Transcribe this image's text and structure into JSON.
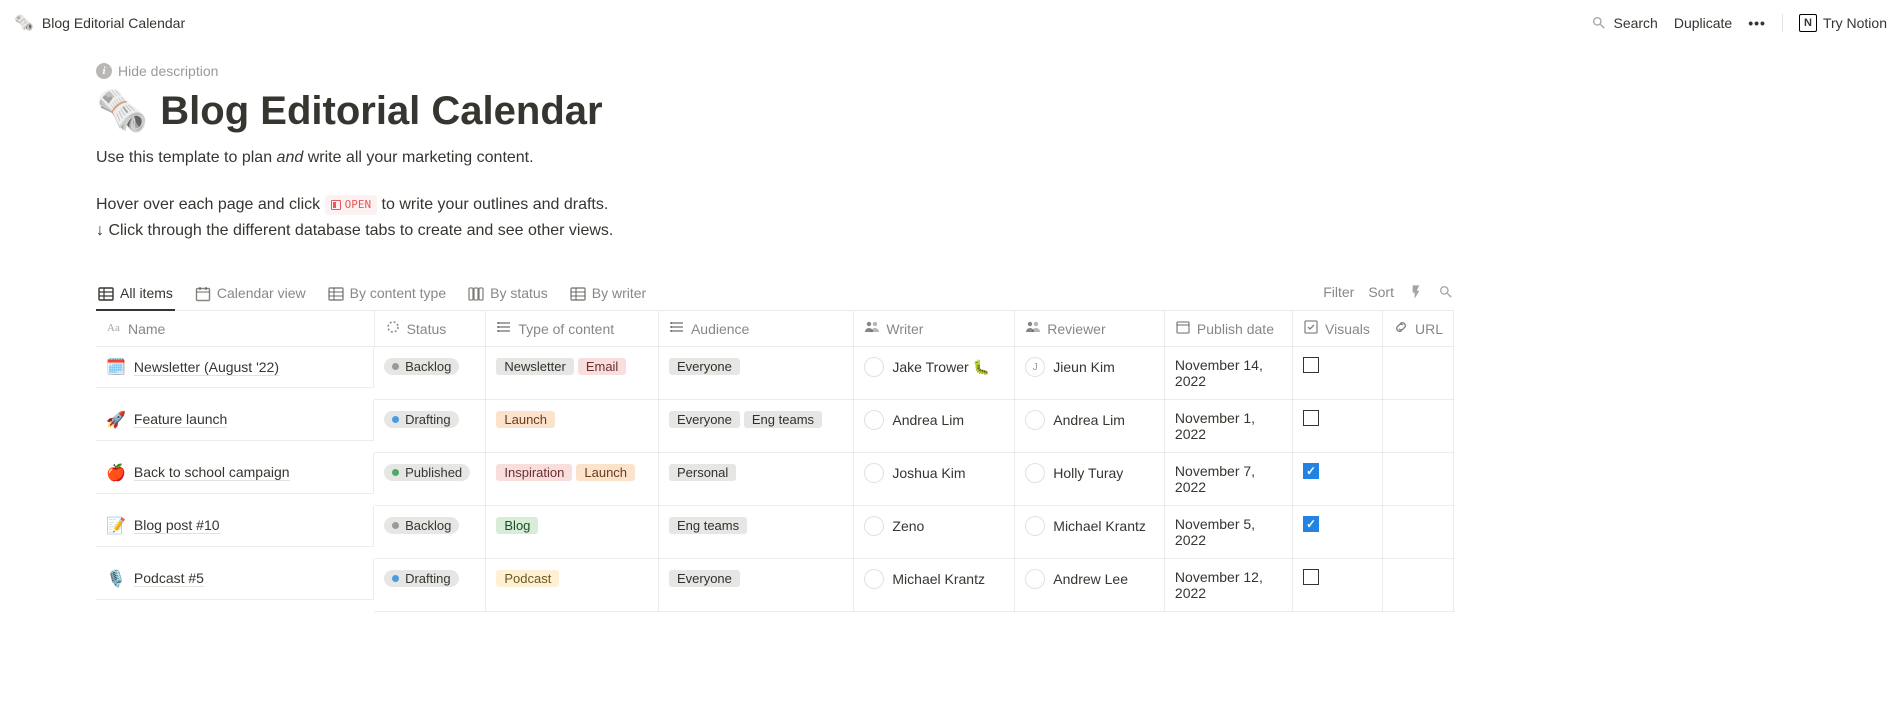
{
  "breadcrumb": {
    "icon": "🗞️",
    "title": "Blog Editorial Calendar"
  },
  "topbar": {
    "search": "Search",
    "duplicate": "Duplicate",
    "try_notion": "Try Notion"
  },
  "hide_description": "Hide description",
  "page": {
    "icon": "🗞️",
    "title": "Blog Editorial Calendar",
    "description_pre": "Use this template to plan ",
    "description_em": "and",
    "description_post": " write all your marketing content.",
    "hint_line1_pre": "Hover over each page and click ",
    "hint_open": "OPEN",
    "hint_line1_post": " to write your outlines and drafts.",
    "hint_line2": "↓ Click through the different database tabs to create and see other views."
  },
  "views": {
    "tabs": [
      {
        "label": "All items",
        "icon": "table",
        "active": true
      },
      {
        "label": "Calendar view",
        "icon": "calendar",
        "active": false
      },
      {
        "label": "By content type",
        "icon": "table",
        "active": false
      },
      {
        "label": "By status",
        "icon": "board",
        "active": false
      },
      {
        "label": "By writer",
        "icon": "table",
        "active": false
      }
    ],
    "actions": {
      "filter": "Filter",
      "sort": "Sort"
    }
  },
  "columns": [
    {
      "key": "name",
      "label": "Name",
      "icon": "title"
    },
    {
      "key": "status",
      "label": "Status",
      "icon": "status"
    },
    {
      "key": "type",
      "label": "Type of content",
      "icon": "multiselect"
    },
    {
      "key": "audience",
      "label": "Audience",
      "icon": "multiselect"
    },
    {
      "key": "writer",
      "label": "Writer",
      "icon": "person"
    },
    {
      "key": "reviewer",
      "label": "Reviewer",
      "icon": "person"
    },
    {
      "key": "date",
      "label": "Publish date",
      "icon": "date"
    },
    {
      "key": "visuals",
      "label": "Visuals",
      "icon": "checkbox"
    },
    {
      "key": "url",
      "label": "URL",
      "icon": "url"
    }
  ],
  "rows": [
    {
      "emoji": "🗓️",
      "title": "Newsletter (August '22)",
      "status": {
        "label": "Backlog",
        "variant": "gray"
      },
      "type": [
        {
          "label": "Newsletter",
          "variant": "default"
        },
        {
          "label": "Email",
          "variant": "pink"
        }
      ],
      "audience": [
        {
          "label": "Everyone",
          "variant": "default"
        }
      ],
      "writer": "Jake Trower 🐛",
      "reviewer": "Jieun Kim",
      "reviewer_initial": "J",
      "date": "November 14, 2022",
      "visuals": false
    },
    {
      "emoji": "🚀",
      "title": "Feature launch",
      "status": {
        "label": "Drafting",
        "variant": "blue"
      },
      "type": [
        {
          "label": "Launch",
          "variant": "orange"
        }
      ],
      "audience": [
        {
          "label": "Everyone",
          "variant": "default"
        },
        {
          "label": "Eng teams",
          "variant": "default"
        }
      ],
      "writer": "Andrea Lim",
      "reviewer": "Andrea Lim",
      "date": "November 1, 2022",
      "visuals": false
    },
    {
      "emoji": "🍎",
      "title": "Back to school campaign",
      "status": {
        "label": "Published",
        "variant": "green"
      },
      "type": [
        {
          "label": "Inspiration",
          "variant": "pink"
        },
        {
          "label": "Launch",
          "variant": "orange"
        }
      ],
      "audience": [
        {
          "label": "Personal",
          "variant": "default"
        }
      ],
      "writer": "Joshua Kim",
      "reviewer": "Holly Turay",
      "date": "November 7, 2022",
      "visuals": true
    },
    {
      "emoji": "📝",
      "title": "Blog post #10",
      "status": {
        "label": "Backlog",
        "variant": "gray"
      },
      "type": [
        {
          "label": "Blog",
          "variant": "green"
        }
      ],
      "audience": [
        {
          "label": "Eng teams",
          "variant": "default"
        }
      ],
      "writer": "Zeno",
      "reviewer": "Michael Krantz",
      "date": "November 5, 2022",
      "visuals": true
    },
    {
      "emoji": "🎙️",
      "title": "Podcast #5",
      "status": {
        "label": "Drafting",
        "variant": "blue"
      },
      "type": [
        {
          "label": "Podcast",
          "variant": "yellow"
        }
      ],
      "audience": [
        {
          "label": "Everyone",
          "variant": "default"
        }
      ],
      "writer": "Michael Krantz",
      "reviewer": "Andrew Lee",
      "date": "November 12, 2022",
      "visuals": false
    }
  ]
}
